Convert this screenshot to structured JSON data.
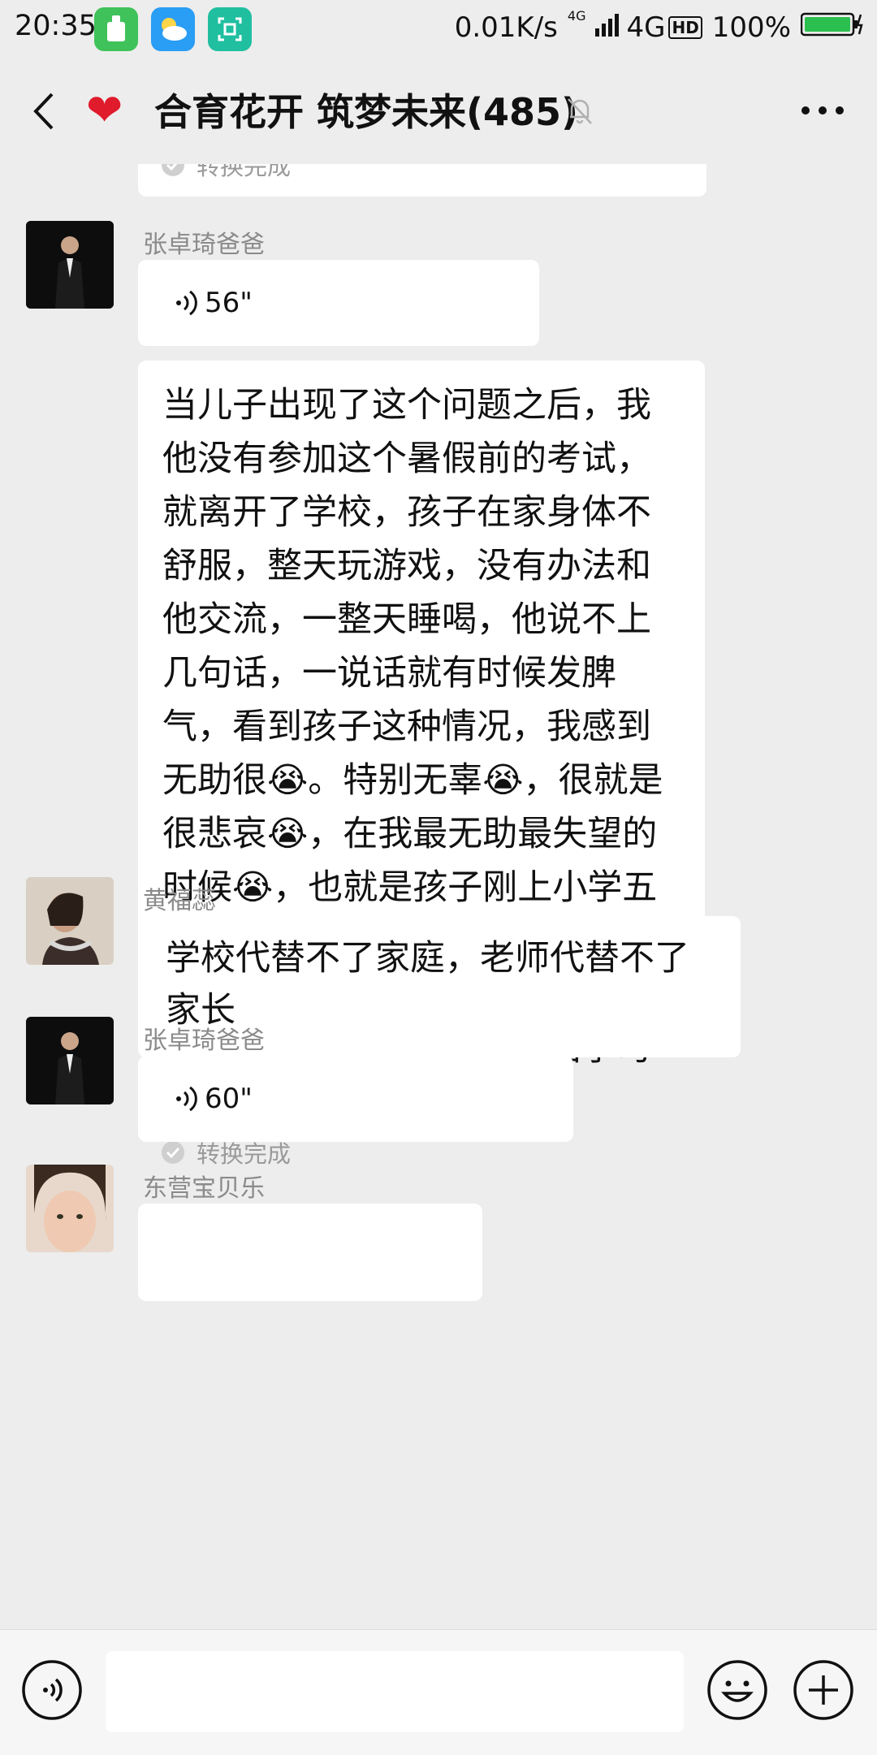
{
  "status": {
    "time": "20:35",
    "speed": "0.01K/s",
    "network_small": "4G",
    "network": "4G",
    "hd": "HD",
    "battery": "100%"
  },
  "chat_header": {
    "title": "合育花开 筑梦未来(485)"
  },
  "messages": [
    {
      "type": "conversion",
      "status": "转换完成"
    },
    {
      "type": "voice",
      "sender": "张卓琦爸爸",
      "duration": "56\""
    },
    {
      "type": "transcript",
      "text": "当儿子出现了这个问题之后，我他没有参加这个暑假前的考试，就离开了学校，孩子在家身体不舒服，整天玩游戏，没有办法和他交流，一整天睡喝，他说不上几句话，一说话就有时候发脾气，看到孩子这种情况，我感到无助很😭。特别无辜😭，很就是很悲哀😭，在我最无助最失望的时候😭，也就是孩子刚上小学五年级的时候，万校长倡导的这个家校合育在我们逐级学区落地，声音成长，我抱折希望开始学习了家庭教育。",
      "status": "转换完成"
    },
    {
      "type": "text",
      "sender": "黄福蕊",
      "text": "学校代替不了家庭，老师代替不了家长"
    },
    {
      "type": "voice",
      "sender": "张卓琦爸爸",
      "duration": "60\""
    },
    {
      "type": "partial",
      "sender": "东营宝贝乐"
    }
  ],
  "colors": {
    "background": "#ededed",
    "bubble": "#ffffff",
    "heart": "#e01b2c",
    "battery": "#2bbf4f"
  },
  "icons": [
    "back-arrow-icon",
    "heart-icon",
    "mute-bell-icon",
    "more-icon",
    "voice-wave-icon",
    "check-circle-icon",
    "voice-input-icon",
    "emoji-icon",
    "plus-icon"
  ]
}
